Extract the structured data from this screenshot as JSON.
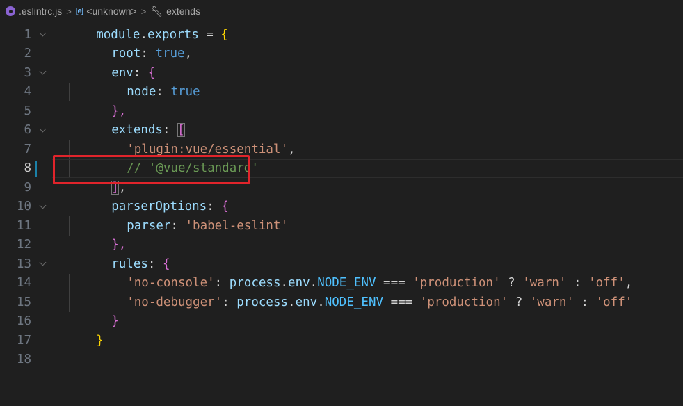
{
  "breadcrumb": {
    "file": ".eslintrc.js",
    "symbol": "<unknown>",
    "property": "extends",
    "sep": ">"
  },
  "editor": {
    "active_line": 8,
    "lines": [
      {
        "n": "1"
      },
      {
        "n": "2"
      },
      {
        "n": "3"
      },
      {
        "n": "4"
      },
      {
        "n": "5"
      },
      {
        "n": "6"
      },
      {
        "n": "7"
      },
      {
        "n": "8"
      },
      {
        "n": "9"
      },
      {
        "n": "10"
      },
      {
        "n": "11"
      },
      {
        "n": "12"
      },
      {
        "n": "13"
      },
      {
        "n": "14"
      },
      {
        "n": "15"
      },
      {
        "n": "16"
      },
      {
        "n": "17"
      },
      {
        "n": "18"
      }
    ],
    "tok": {
      "module": "module",
      "dot": ".",
      "exports": "exports",
      "eq": " = ",
      "lbrace": "{",
      "root": "root",
      "colon": ": ",
      "true": "true",
      "comma": ",",
      "env": "env",
      "node": "node",
      "rbrace_comma": "},",
      "extends": "extends",
      "lbracket": "[",
      "plugin": "'plugin:vue/essential'",
      "comment": "// '@vue/standard'",
      "rbracket": "]",
      "comma2": ",",
      "parserOptions": "parserOptions",
      "parser": "parser",
      "babel": "'babel-eslint'",
      "rules": "rules",
      "noconsole": "'no-console'",
      "nodebugger": "'no-debugger'",
      "process": "process",
      "envp": "env",
      "NODE_ENV": "NODE_ENV",
      "triple": " === ",
      "production": "'production'",
      "q": " ? ",
      "warn": "'warn'",
      "c": " : ",
      "off": "'off'",
      "rbrace": "}"
    }
  }
}
